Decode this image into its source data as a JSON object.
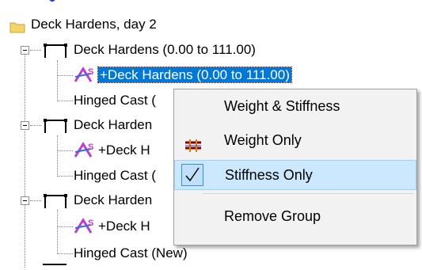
{
  "tree": {
    "top_partial": "",
    "root_label": "Deck Hardens, day 2",
    "groups": [
      {
        "label": "Deck Hardens (0.00 to 111.00)",
        "child_label": "+Deck Hardens (0.00 to 111.00)",
        "sibling_label": "Hinged Cast ("
      },
      {
        "label": "Deck Harden",
        "child_label": "+Deck H",
        "sibling_label": "Hinged Cast ("
      },
      {
        "label": "Deck Harden",
        "child_label": "+Deck H",
        "sibling_label": "Hinged Cast (New)"
      }
    ]
  },
  "context_menu": {
    "items": [
      {
        "label": "Weight & Stiffness",
        "icon": "none",
        "checked": false,
        "highlighted": false
      },
      {
        "label": "Weight Only",
        "icon": "weight-grid-icon",
        "checked": false,
        "highlighted": false
      },
      {
        "label": "Stiffness Only",
        "icon": "check-icon",
        "checked": true,
        "highlighted": true
      },
      {
        "label": "Remove Group",
        "icon": "none",
        "checked": false,
        "highlighted": false
      }
    ]
  },
  "colors": {
    "selection": "#0078d7",
    "menu_highlight": "#cce8ff",
    "folder": "#f5d46a"
  }
}
